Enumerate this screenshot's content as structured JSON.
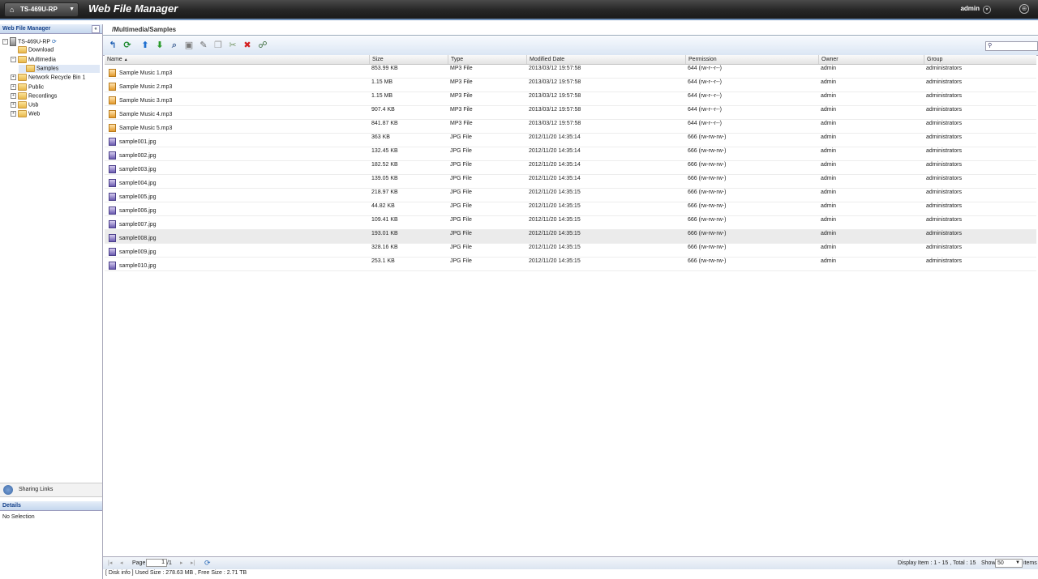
{
  "topbar": {
    "device": "TS-469U-RP",
    "app_title": "Web File Manager",
    "user": "admin"
  },
  "left": {
    "title": "Web File Manager",
    "tree": [
      {
        "label": "TS-469U-RP",
        "level": 0,
        "toggle": "⊟",
        "icon": "server-icon"
      },
      {
        "label": "Download",
        "level": 1,
        "toggle": "",
        "icon": "folder-icon"
      },
      {
        "label": "Multimedia",
        "level": 1,
        "toggle": "⊟",
        "icon": "folder-open-icon"
      },
      {
        "label": "Samples",
        "level": 2,
        "toggle": "",
        "icon": "folder-icon",
        "selected": true
      },
      {
        "label": "Network Recycle Bin 1",
        "level": 1,
        "toggle": "⊞",
        "icon": "folder-icon"
      },
      {
        "label": "Public",
        "level": 1,
        "toggle": "⊞",
        "icon": "folder-icon"
      },
      {
        "label": "Recordings",
        "level": 1,
        "toggle": "⊞",
        "icon": "folder-icon"
      },
      {
        "label": "Usb",
        "level": 1,
        "toggle": "⊞",
        "icon": "folder-icon"
      },
      {
        "label": "Web",
        "level": 1,
        "toggle": "⊞",
        "icon": "folder-icon"
      }
    ],
    "sharing_links": "Sharing Links",
    "details_title": "Details",
    "details_body": "No Selection"
  },
  "main": {
    "path": "/Multimedia/Samples",
    "columns": [
      "Name",
      "Size",
      "Type",
      "Modified Date",
      "Permission",
      "Owner",
      "Group"
    ],
    "sort_arrow": "▲",
    "rows": [
      {
        "name": "Sample Music 1.mp3",
        "size": "853.99 KB",
        "type": "MP3 File",
        "date": "2013/03/12 19:57:58",
        "perm": "644 (rw-r--r--)",
        "owner": "admin",
        "group": "administrators",
        "icon": "mp3"
      },
      {
        "name": "Sample Music 2.mp3",
        "size": "1.15 MB",
        "type": "MP3 File",
        "date": "2013/03/12 19:57:58",
        "perm": "644 (rw-r--r--)",
        "owner": "admin",
        "group": "administrators",
        "icon": "mp3"
      },
      {
        "name": "Sample Music 3.mp3",
        "size": "1.15 MB",
        "type": "MP3 File",
        "date": "2013/03/12 19:57:58",
        "perm": "644 (rw-r--r--)",
        "owner": "admin",
        "group": "administrators",
        "icon": "mp3"
      },
      {
        "name": "Sample Music 4.mp3",
        "size": "907.4 KB",
        "type": "MP3 File",
        "date": "2013/03/12 19:57:58",
        "perm": "644 (rw-r--r--)",
        "owner": "admin",
        "group": "administrators",
        "icon": "mp3"
      },
      {
        "name": "Sample Music 5.mp3",
        "size": "841.87 KB",
        "type": "MP3 File",
        "date": "2013/03/12 19:57:58",
        "perm": "644 (rw-r--r--)",
        "owner": "admin",
        "group": "administrators",
        "icon": "mp3"
      },
      {
        "name": "sample001.jpg",
        "size": "363 KB",
        "type": "JPG File",
        "date": "2012/11/20 14:35:14",
        "perm": "666 (rw-rw-rw-)",
        "owner": "admin",
        "group": "administrators",
        "icon": "jpg"
      },
      {
        "name": "sample002.jpg",
        "size": "132.45 KB",
        "type": "JPG File",
        "date": "2012/11/20 14:35:14",
        "perm": "666 (rw-rw-rw-)",
        "owner": "admin",
        "group": "administrators",
        "icon": "jpg"
      },
      {
        "name": "sample003.jpg",
        "size": "182.52 KB",
        "type": "JPG File",
        "date": "2012/11/20 14:35:14",
        "perm": "666 (rw-rw-rw-)",
        "owner": "admin",
        "group": "administrators",
        "icon": "jpg"
      },
      {
        "name": "sample004.jpg",
        "size": "139.05 KB",
        "type": "JPG File",
        "date": "2012/11/20 14:35:14",
        "perm": "666 (rw-rw-rw-)",
        "owner": "admin",
        "group": "administrators",
        "icon": "jpg"
      },
      {
        "name": "sample005.jpg",
        "size": "218.97 KB",
        "type": "JPG File",
        "date": "2012/11/20 14:35:15",
        "perm": "666 (rw-rw-rw-)",
        "owner": "admin",
        "group": "administrators",
        "icon": "jpg"
      },
      {
        "name": "sample006.jpg",
        "size": "44.82 KB",
        "type": "JPG File",
        "date": "2012/11/20 14:35:15",
        "perm": "666 (rw-rw-rw-)",
        "owner": "admin",
        "group": "administrators",
        "icon": "jpg"
      },
      {
        "name": "sample007.jpg",
        "size": "109.41 KB",
        "type": "JPG File",
        "date": "2012/11/20 14:35:15",
        "perm": "666 (rw-rw-rw-)",
        "owner": "admin",
        "group": "administrators",
        "icon": "jpg"
      },
      {
        "name": "sample008.jpg",
        "size": "193.01 KB",
        "type": "JPG File",
        "date": "2012/11/20 14:35:15",
        "perm": "666 (rw-rw-rw-)",
        "owner": "admin",
        "group": "administrators",
        "icon": "jpg",
        "highlight": true
      },
      {
        "name": "sample009.jpg",
        "size": "328.16 KB",
        "type": "JPG File",
        "date": "2012/11/20 14:35:15",
        "perm": "666 (rw-rw-rw-)",
        "owner": "admin",
        "group": "administrators",
        "icon": "jpg"
      },
      {
        "name": "sample010.jpg",
        "size": "253.1 KB",
        "type": "JPG File",
        "date": "2012/11/20 14:35:15",
        "perm": "666 (rw-rw-rw-)",
        "owner": "admin",
        "group": "administrators",
        "icon": "jpg"
      }
    ]
  },
  "toolbar": [
    {
      "name": "back-icon",
      "glyph": "↰",
      "color": "#1e5fb3"
    },
    {
      "name": "refresh-icon",
      "glyph": "⟳",
      "color": "#1d8a2e"
    },
    {
      "name": "upload-icon",
      "glyph": "⬆",
      "color": "#1e6fd0"
    },
    {
      "name": "download-icon",
      "glyph": "⬇",
      "color": "#2a9a2a"
    },
    {
      "name": "zoom-icon",
      "glyph": "⌕",
      "color": "#4a6a9a"
    },
    {
      "name": "new-folder-icon",
      "glyph": "▣",
      "color": "#7a7a7a"
    },
    {
      "name": "rename-icon",
      "glyph": "✎",
      "color": "#6a6a6a"
    },
    {
      "name": "copy-icon",
      "glyph": "❐",
      "color": "#9a9a9a"
    },
    {
      "name": "move-icon",
      "glyph": "✂",
      "color": "#7a9a6a"
    },
    {
      "name": "delete-icon",
      "glyph": "✖",
      "color": "#d42020"
    },
    {
      "name": "share-icon",
      "glyph": "☍",
      "color": "#3a6a3a"
    }
  ],
  "footer": {
    "page_label": "Page",
    "page_value": "1",
    "page_total": "/1",
    "display_info": "Display Item : 1 - 15 , Total : 15",
    "show_label": "Show",
    "show_value": "50",
    "items_label": "items",
    "disk_info": "[ Disk info ] Used Size : 278.63 MB , Free Size : 2.71 TB"
  }
}
